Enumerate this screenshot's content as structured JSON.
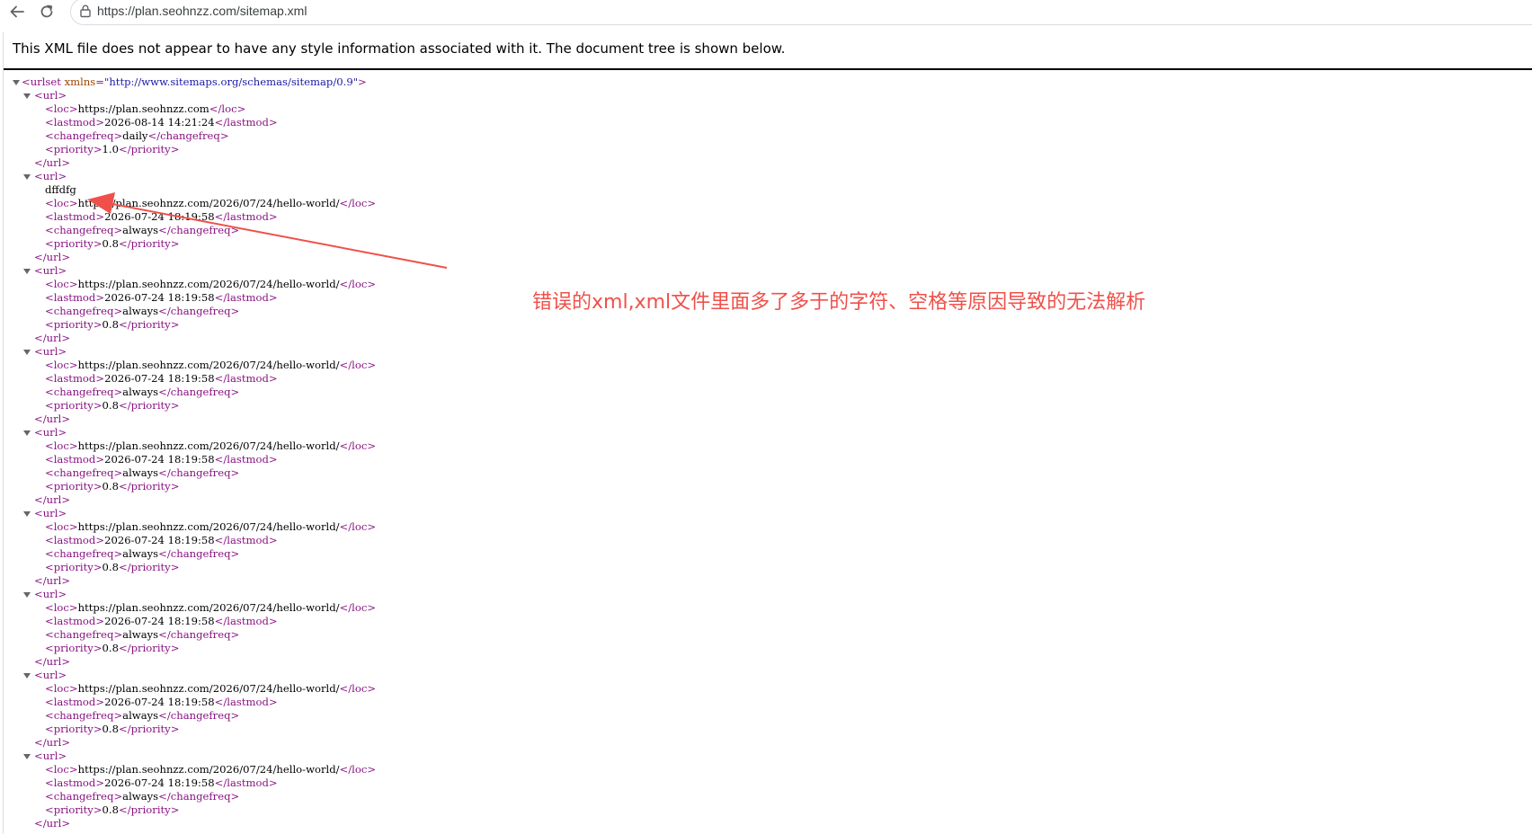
{
  "browser": {
    "url": "https://plan.seohnzz.com/sitemap.xml",
    "back_icon": "arrow-left-icon",
    "reload_icon": "reload-icon",
    "secure_icon": "site-info-icon"
  },
  "page": {
    "info_message": "This XML file does not appear to have any style information associated with it. The document tree is shown below."
  },
  "xml": {
    "root_open_tag": "<urlset",
    "root_attr_name": "xmlns",
    "root_attr_value": "\"http://www.sitemaps.org/schemas/sitemap/0.9\"",
    "root_open_end": ">",
    "entries": [
      {
        "loc": "https://plan.seohnzz.com",
        "lastmod": "2026-08-14 14:21:24",
        "changefreq": "daily",
        "priority": "1.0",
        "stray_text": ""
      },
      {
        "loc": "https://plan.seohnzz.com/2026/07/24/hello-world/",
        "lastmod": "2026-07-24 18:19:58",
        "changefreq": "always",
        "priority": "0.8",
        "stray_text": "dffdfg"
      },
      {
        "loc": "https://plan.seohnzz.com/2026/07/24/hello-world/",
        "lastmod": "2026-07-24 18:19:58",
        "changefreq": "always",
        "priority": "0.8",
        "stray_text": ""
      },
      {
        "loc": "https://plan.seohnzz.com/2026/07/24/hello-world/",
        "lastmod": "2026-07-24 18:19:58",
        "changefreq": "always",
        "priority": "0.8",
        "stray_text": ""
      },
      {
        "loc": "https://plan.seohnzz.com/2026/07/24/hello-world/",
        "lastmod": "2026-07-24 18:19:58",
        "changefreq": "always",
        "priority": "0.8",
        "stray_text": ""
      },
      {
        "loc": "https://plan.seohnzz.com/2026/07/24/hello-world/",
        "lastmod": "2026-07-24 18:19:58",
        "changefreq": "always",
        "priority": "0.8",
        "stray_text": ""
      },
      {
        "loc": "https://plan.seohnzz.com/2026/07/24/hello-world/",
        "lastmod": "2026-07-24 18:19:58",
        "changefreq": "always",
        "priority": "0.8",
        "stray_text": ""
      },
      {
        "loc": "https://plan.seohnzz.com/2026/07/24/hello-world/",
        "lastmod": "2026-07-24 18:19:58",
        "changefreq": "always",
        "priority": "0.8",
        "stray_text": ""
      },
      {
        "loc": "https://plan.seohnzz.com/2026/07/24/hello-world/",
        "lastmod": "2026-07-24 18:19:58",
        "changefreq": "always",
        "priority": "0.8",
        "stray_text": ""
      }
    ]
  },
  "annotation": {
    "text": "错误的xml,xml文件里面多了多于的字符、空格等原因导致的无法解析",
    "color": "#f0504a"
  }
}
